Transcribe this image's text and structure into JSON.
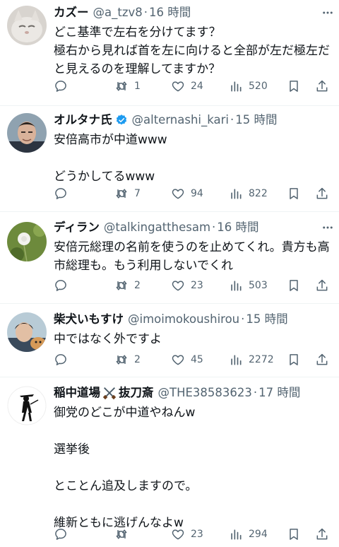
{
  "tweets": [
    {
      "name": "カズー",
      "handle": "@a_tzv8",
      "dot": "·",
      "time": "16 時間",
      "text": "どこ基準で左右を分けてます？\n極右から見れば首を左に向けると全部が左だ極左だと見えるのを理解してますか？",
      "retweets": "1",
      "likes": "24",
      "views": "520",
      "avatar": "cat-photo"
    },
    {
      "name": "オルタナ氏",
      "verified": true,
      "handle": "@alternashi_kari",
      "dot": "·",
      "time": "15 時間",
      "text": "安倍高市が中道www\n\nどうかしてるwww",
      "retweets": "7",
      "likes": "94",
      "views": "822",
      "avatar": "man-photo"
    },
    {
      "name": "ディラン",
      "handle": "@talkingatthesam",
      "dot": "·",
      "time": "16 時間",
      "text": "安倍元総理の名前を使うのを止めてくれ。貴方も高市総理も。もう利用しないでくれ",
      "retweets": "2",
      "likes": "23",
      "views": "503",
      "avatar": "dandelion-photo"
    },
    {
      "name": "柴犬いもすけ",
      "handle": "@imoimokoushirou",
      "dot": "·",
      "time": "15 時間",
      "text": "中ではなく外ですよ",
      "retweets": "2",
      "likes": "45",
      "views": "2272",
      "avatar": "boy-with-dog-photo"
    },
    {
      "name_prefix": "稲中道場",
      "name_suffix": "抜刀斎",
      "handle": "@THE38583623",
      "dot": "·",
      "time": "17 時間",
      "text": "御党のどこが中道やねんw\n\n選挙後\n\nとことん追及しますので。\n\n維新ともに逃げんなよw",
      "retweets": "",
      "likes": "23",
      "views": "294",
      "avatar": "samurai-silhouette"
    }
  ],
  "colors": {
    "text": "#0f1419",
    "secondary": "#536471",
    "divider": "#eff3f4",
    "verified": "#1d9bf0"
  }
}
